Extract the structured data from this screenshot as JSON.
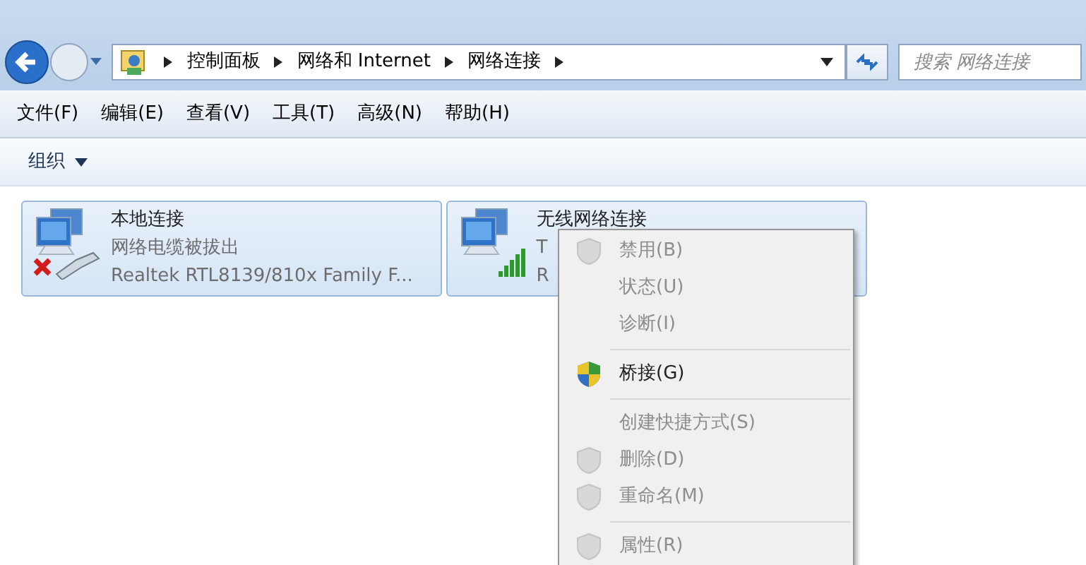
{
  "address_bar": {
    "breadcrumbs": [
      "控制面板",
      "网络和 Internet",
      "网络连接"
    ],
    "search": {
      "placeholder": "搜索 网络连接"
    }
  },
  "menu_bar": [
    "文件(F)",
    "编辑(E)",
    "查看(V)",
    "工具(T)",
    "高级(N)",
    "帮助(H)"
  ],
  "toolbar": {
    "organize": "组织"
  },
  "connections": [
    {
      "name": "本地连接",
      "status": "网络电缆被拔出",
      "adapter": "Realtek RTL8139/810x Family F...",
      "kind": "disconnected",
      "selected": true
    },
    {
      "name": "无线网络连接",
      "status": "T",
      "adapter": "R",
      "kind": "wireless",
      "selected": true
    }
  ],
  "context_menu": [
    {
      "kind": "item",
      "label": "禁用(B)",
      "disabled": true,
      "shield": true
    },
    {
      "kind": "item",
      "label": "状态(U)",
      "disabled": true,
      "shield": false
    },
    {
      "kind": "item",
      "label": "诊断(I)",
      "disabled": true,
      "shield": false
    },
    {
      "kind": "separator"
    },
    {
      "kind": "item",
      "label": "桥接(G)",
      "disabled": false,
      "shield": true
    },
    {
      "kind": "separator"
    },
    {
      "kind": "item",
      "label": "创建快捷方式(S)",
      "disabled": true,
      "shield": false
    },
    {
      "kind": "item",
      "label": "删除(D)",
      "disabled": true,
      "shield": true
    },
    {
      "kind": "item",
      "label": "重命名(M)",
      "disabled": true,
      "shield": true
    },
    {
      "kind": "separator"
    },
    {
      "kind": "item",
      "label": "属性(R)",
      "disabled": true,
      "shield": true
    }
  ]
}
